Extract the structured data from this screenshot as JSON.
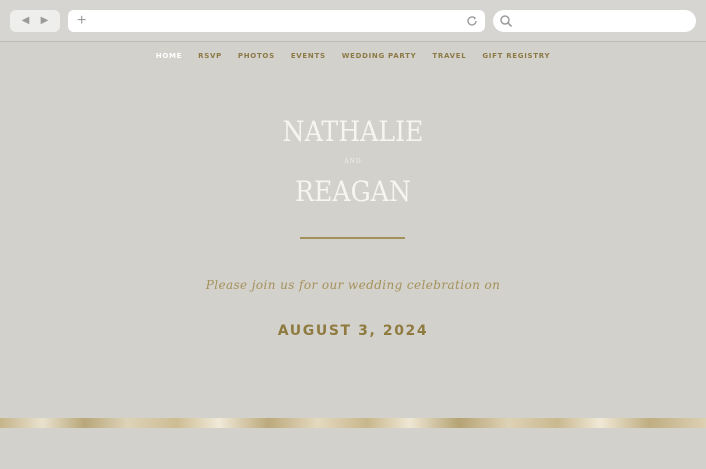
{
  "browser": {
    "back_icon": "back-arrow-icon",
    "forward_icon": "forward-arrow-icon",
    "new_tab_icon": "plus-icon",
    "reload_icon": "reload-icon",
    "search_icon": "search-icon"
  },
  "nav": {
    "items": [
      {
        "label": "HOME",
        "active": true
      },
      {
        "label": "RSVP"
      },
      {
        "label": "PHOTOS"
      },
      {
        "label": "EVENTS"
      },
      {
        "label": "WEDDING PARTY"
      },
      {
        "label": "TRAVEL"
      },
      {
        "label": "GIFT REGISTRY"
      }
    ]
  },
  "hero": {
    "name_one": "NATHALIE",
    "conjunction": "AND",
    "name_two": "REAGAN",
    "invitation": "Please join us for our wedding celebration on",
    "date": "AUGUST 3, 2024"
  },
  "colors": {
    "background": "#d3d1cc",
    "gold": "#8f7b3f",
    "names": "#f6f5f2"
  }
}
